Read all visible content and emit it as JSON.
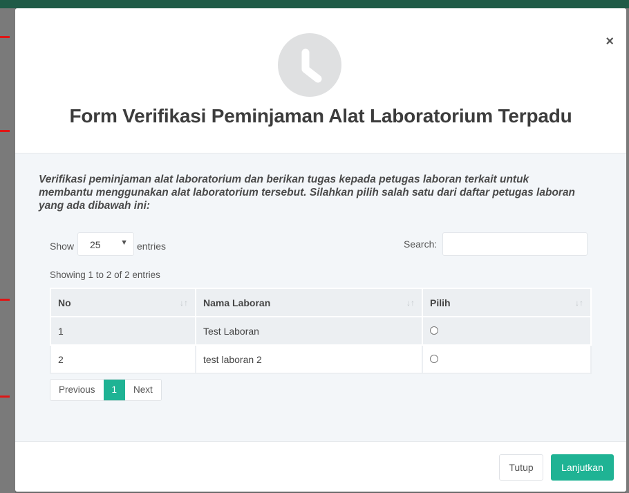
{
  "modal": {
    "close_label": "×",
    "title": "Form Verifikasi Peminjaman Alat Laboratorium Terpadu",
    "icon": "clock-icon",
    "intro": "Verifikasi peminjaman alat laboratorium dan berikan tugas kepada petugas laboran terkait untuk membantu menggunakan alat laboratorium tersebut. Silahkan pilih salah satu dari daftar petugas laboran yang ada dibawah ini:"
  },
  "datatable": {
    "show_label": "Show",
    "entries_value": "25",
    "entries_label": "entries",
    "search_label": "Search:",
    "search_value": "",
    "info": "Showing 1 to 2 of 2 entries",
    "columns": [
      "No",
      "Nama Laboran",
      "Pilih"
    ],
    "rows": [
      {
        "no": "1",
        "nama": "Test Laboran"
      },
      {
        "no": "2",
        "nama": "test laboran 2"
      }
    ],
    "pagination": {
      "previous": "Previous",
      "current": "1",
      "next": "Next"
    }
  },
  "footer": {
    "tutup_label": "Tutup",
    "lanjutkan_label": "Lanjutkan"
  },
  "colors": {
    "accent": "#1fb394",
    "backdrop_header": "#1f5b47",
    "marker": "#e01515"
  }
}
